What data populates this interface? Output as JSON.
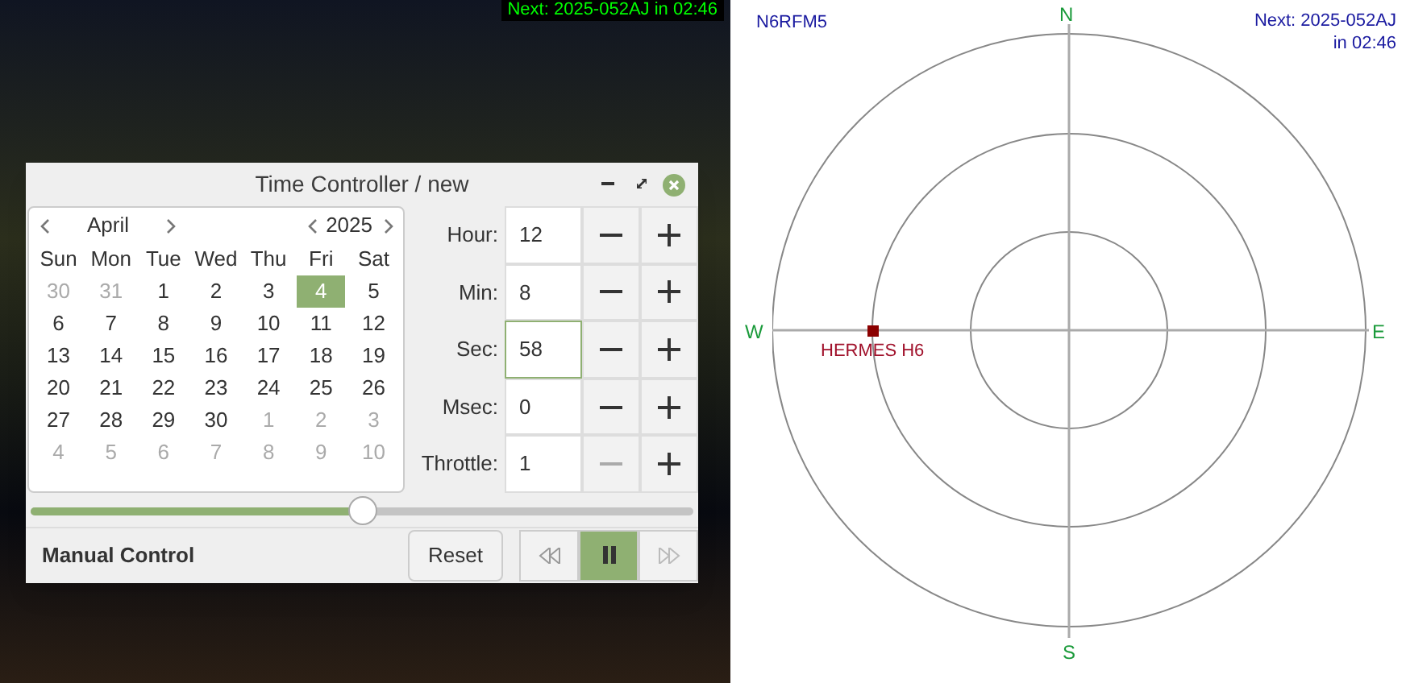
{
  "map": {
    "overlay_text": "Next: 2025-052AJ in 02:46"
  },
  "dialog": {
    "title": "Time Controller / new",
    "calendar": {
      "month": "April",
      "year": "2025",
      "weekdays": [
        "Sun",
        "Mon",
        "Tue",
        "Wed",
        "Thu",
        "Fri",
        "Sat"
      ],
      "days": [
        {
          "label": "30",
          "kind": "other",
          "selected": false
        },
        {
          "label": "31",
          "kind": "other",
          "selected": false
        },
        {
          "label": "1",
          "kind": "current",
          "selected": false
        },
        {
          "label": "2",
          "kind": "current",
          "selected": false
        },
        {
          "label": "3",
          "kind": "current",
          "selected": false
        },
        {
          "label": "4",
          "kind": "current",
          "selected": true
        },
        {
          "label": "5",
          "kind": "current",
          "selected": false
        },
        {
          "label": "6",
          "kind": "current",
          "selected": false
        },
        {
          "label": "7",
          "kind": "current",
          "selected": false
        },
        {
          "label": "8",
          "kind": "current",
          "selected": false
        },
        {
          "label": "9",
          "kind": "current",
          "selected": false
        },
        {
          "label": "10",
          "kind": "current",
          "selected": false
        },
        {
          "label": "11",
          "kind": "current",
          "selected": false
        },
        {
          "label": "12",
          "kind": "current",
          "selected": false
        },
        {
          "label": "13",
          "kind": "current",
          "selected": false
        },
        {
          "label": "14",
          "kind": "current",
          "selected": false
        },
        {
          "label": "15",
          "kind": "current",
          "selected": false
        },
        {
          "label": "16",
          "kind": "current",
          "selected": false
        },
        {
          "label": "17",
          "kind": "current",
          "selected": false
        },
        {
          "label": "18",
          "kind": "current",
          "selected": false
        },
        {
          "label": "19",
          "kind": "current",
          "selected": false
        },
        {
          "label": "20",
          "kind": "current",
          "selected": false
        },
        {
          "label": "21",
          "kind": "current",
          "selected": false
        },
        {
          "label": "22",
          "kind": "current",
          "selected": false
        },
        {
          "label": "23",
          "kind": "current",
          "selected": false
        },
        {
          "label": "24",
          "kind": "current",
          "selected": false
        },
        {
          "label": "25",
          "kind": "current",
          "selected": false
        },
        {
          "label": "26",
          "kind": "current",
          "selected": false
        },
        {
          "label": "27",
          "kind": "current",
          "selected": false
        },
        {
          "label": "28",
          "kind": "current",
          "selected": false
        },
        {
          "label": "29",
          "kind": "current",
          "selected": false
        },
        {
          "label": "30",
          "kind": "current",
          "selected": false
        },
        {
          "label": "1",
          "kind": "other",
          "selected": false
        },
        {
          "label": "2",
          "kind": "other",
          "selected": false
        },
        {
          "label": "3",
          "kind": "other",
          "selected": false
        },
        {
          "label": "4",
          "kind": "other",
          "selected": false
        },
        {
          "label": "5",
          "kind": "other",
          "selected": false
        },
        {
          "label": "6",
          "kind": "other",
          "selected": false
        },
        {
          "label": "7",
          "kind": "other",
          "selected": false
        },
        {
          "label": "8",
          "kind": "other",
          "selected": false
        },
        {
          "label": "9",
          "kind": "other",
          "selected": false
        },
        {
          "label": "10",
          "kind": "other",
          "selected": false
        }
      ]
    },
    "fields": [
      {
        "label": "Hour:",
        "value": "12",
        "focused": false,
        "minus_disabled": false
      },
      {
        "label": "Min:",
        "value": "8",
        "focused": false,
        "minus_disabled": false
      },
      {
        "label": "Sec:",
        "value": "58",
        "focused": true,
        "minus_disabled": false
      },
      {
        "label": "Msec:",
        "value": "0",
        "focused": false,
        "minus_disabled": false
      },
      {
        "label": "Throttle:",
        "value": "1",
        "focused": false,
        "minus_disabled": true
      }
    ],
    "slider": {
      "level": 0.5
    },
    "mode_label": "Manual Control",
    "reset_button": "Reset",
    "playback": [
      {
        "kind": "rewind",
        "active": false,
        "disabled": false
      },
      {
        "kind": "pause",
        "active": true,
        "disabled": false
      },
      {
        "kind": "forward",
        "active": false,
        "disabled": true
      }
    ]
  },
  "polar": {
    "station": "N6RFM5",
    "next_pass": "Next: 2025-052AJ",
    "next_time": "in 02:46",
    "directions": [
      "N",
      "E",
      "S",
      "W"
    ],
    "satellite": {
      "name": "HERMES H6"
    }
  }
}
